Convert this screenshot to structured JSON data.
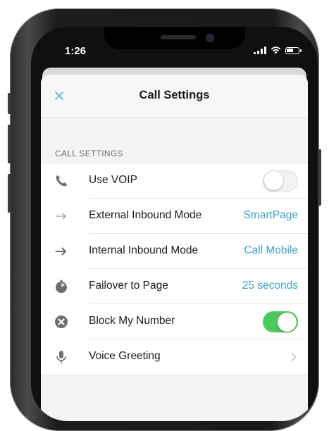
{
  "status_bar": {
    "time": "1:26"
  },
  "nav": {
    "title": "Call Settings",
    "close_icon": "close-icon"
  },
  "section": {
    "header": "CALL SETTINGS"
  },
  "colors": {
    "accent": "#3ea3c8",
    "toggle_on": "#4cc95e",
    "icon_gray": "#6d6d72"
  },
  "rows": [
    {
      "label": "Use VOIP",
      "icon": "phone-icon",
      "control": "toggle",
      "toggle_on": false
    },
    {
      "label": "External Inbound Mode",
      "icon": "arrow-right-light-icon",
      "value": "SmartPage"
    },
    {
      "label": "Internal Inbound Mode",
      "icon": "arrow-right-icon",
      "value": "Call Mobile"
    },
    {
      "label": "Failover to Page",
      "icon": "timer-icon",
      "value": "25 seconds"
    },
    {
      "label": "Block My Number",
      "icon": "block-icon",
      "control": "toggle",
      "toggle_on": true
    },
    {
      "label": "Voice Greeting",
      "icon": "microphone-icon",
      "control": "chevron"
    }
  ]
}
